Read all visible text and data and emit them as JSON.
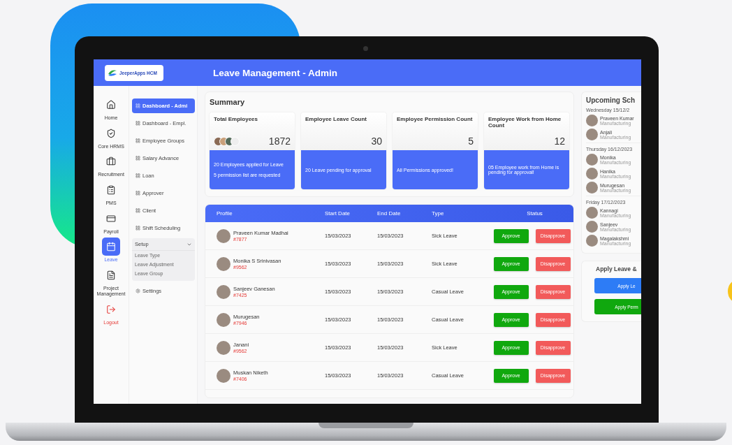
{
  "header": {
    "logo": "JeeperApps HCM",
    "title": "Leave Management - Admin"
  },
  "rail": [
    {
      "label": "Home",
      "kind": "nav",
      "selected": false
    },
    {
      "label": "Core HRMS",
      "kind": "nav",
      "selected": false
    },
    {
      "label": "Recruitment",
      "kind": "nav",
      "selected": false
    },
    {
      "label": "PMS",
      "kind": "nav",
      "selected": false
    },
    {
      "label": "Payroll",
      "kind": "nav",
      "selected": false
    },
    {
      "label": "Leave",
      "kind": "nav",
      "selected": true
    },
    {
      "label": "Project Management",
      "kind": "nav",
      "selected": false
    },
    {
      "label": "Logout",
      "kind": "logout",
      "selected": false
    }
  ],
  "submenu": [
    {
      "label": "Dashboard - Admi",
      "kind": "link",
      "selected": true
    },
    {
      "label": "Dashboard - Empl.",
      "kind": "link",
      "selected": false
    },
    {
      "label": "Employee Groups",
      "kind": "link",
      "selected": false
    },
    {
      "label": "Salary Advance",
      "kind": "link",
      "selected": false
    },
    {
      "label": "Loan",
      "kind": "link",
      "selected": false
    },
    {
      "label": "Approver",
      "kind": "link",
      "selected": false
    },
    {
      "label": "Client",
      "kind": "link",
      "selected": false
    },
    {
      "label": "Shift Scheduling",
      "kind": "link",
      "selected": false
    },
    {
      "label": "Setup",
      "kind": "group",
      "expanded": true,
      "children": [
        {
          "label": "Leave Type"
        },
        {
          "label": "Leave Adjustment"
        },
        {
          "label": "Leave Group"
        }
      ]
    },
    {
      "label": "Settings",
      "kind": "settings",
      "selected": false
    }
  ],
  "summary": {
    "title": "Summary",
    "cards": [
      {
        "title": "Total Employees",
        "value": "1872",
        "avatars": true,
        "notes": [
          "20 Employees applied for Leave",
          "5 permission list are requested"
        ]
      },
      {
        "title": "Employee Leave Count",
        "value": "30",
        "avatars": false,
        "notes": [
          "20 Leave pending for approval"
        ]
      },
      {
        "title": "Employee Permission Count",
        "value": "5",
        "avatars": false,
        "notes": [
          "All Permissions approved!"
        ]
      },
      {
        "title": "Employee Work from Home Count",
        "value": "12",
        "avatars": false,
        "notes": [
          "05 Employee work from Home is pending for approval!"
        ]
      }
    ]
  },
  "table": {
    "columns": [
      "Profile",
      "Start Date",
      "End Date",
      "Type",
      "Status"
    ],
    "rows": [
      {
        "name": "Praveen Kumar Madhai",
        "id": "#7877",
        "start": "15/03/2023",
        "end": "15/03/2023",
        "type": "Sick Leave",
        "approve": "Approve",
        "disapprove": "Disapprove"
      },
      {
        "name": "Monika S Srinivasan",
        "id": "#9562",
        "start": "15/03/2023",
        "end": "15/03/2023",
        "type": "Sick Leave",
        "approve": "Approve",
        "disapprove": "Disapprove"
      },
      {
        "name": "Sanjeev Ganesan",
        "id": "#7425",
        "start": "15/03/2023",
        "end": "15/03/2023",
        "type": "Casual Leave",
        "approve": "Approve",
        "disapprove": "Disapprove"
      },
      {
        "name": "Murugesan",
        "id": "#7946",
        "start": "15/03/2023",
        "end": "15/03/2023",
        "type": "Casual Leave",
        "approve": "Approve",
        "disapprove": "Disapprove"
      },
      {
        "name": "Janani",
        "id": "#9562",
        "start": "15/03/2023",
        "end": "15/03/2023",
        "type": "Sick Leave",
        "approve": "Approve",
        "disapprove": "Disapprove"
      },
      {
        "name": "Muskan Niketh",
        "id": "#7406",
        "start": "15/03/2023",
        "end": "15/03/2023",
        "type": "Casual Leave",
        "approve": "Approve",
        "disapprove": "Disapprove"
      }
    ]
  },
  "schedule": {
    "title": "Upcoming Sch",
    "days": [
      {
        "date": "Wednesday 15/12/2",
        "people": [
          {
            "name": "Praveen Kumar",
            "dept": "Manufacturing"
          },
          {
            "name": "Anjali",
            "dept": "Manufacturing"
          }
        ]
      },
      {
        "date": "Thursday 16/12/2023",
        "people": [
          {
            "name": "Monika",
            "dept": "Manufacturing"
          },
          {
            "name": "Hanika",
            "dept": "Manufacturing"
          },
          {
            "name": "Murugesan",
            "dept": "Manufacturing"
          }
        ]
      },
      {
        "date": "Friday 17/12/2023",
        "people": [
          {
            "name": "Kannagi",
            "dept": "Manufacturing"
          },
          {
            "name": "Sanjeev",
            "dept": "Manufacturing"
          },
          {
            "name": "Magalakshmi",
            "dept": "Manufacturing"
          }
        ]
      }
    ]
  },
  "apply": {
    "title": "Apply Leave &",
    "buttons": [
      {
        "label": "Apply Le",
        "kind": "leave"
      },
      {
        "label": "Apply Perm",
        "kind": "permission"
      }
    ]
  }
}
